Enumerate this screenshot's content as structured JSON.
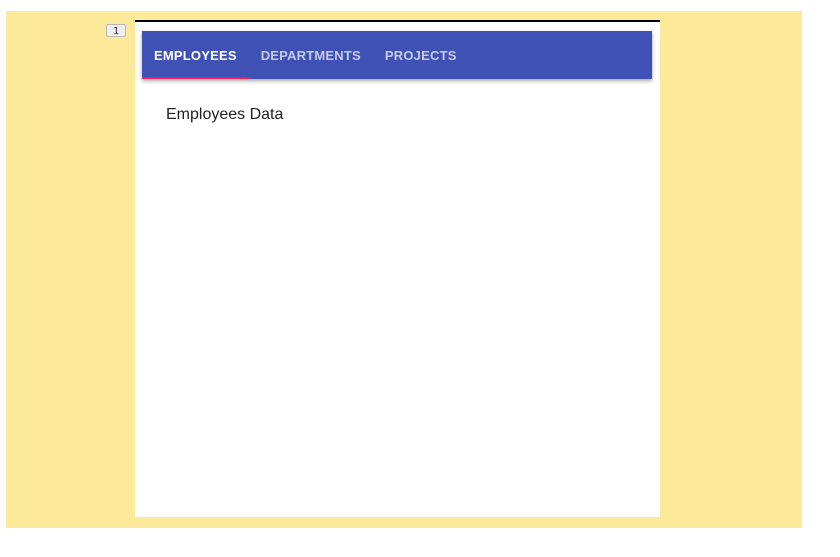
{
  "badge": {
    "label": "1"
  },
  "tabs": [
    {
      "label": "EMPLOYEES",
      "active": true
    },
    {
      "label": "DEPARTMENTS",
      "active": false
    },
    {
      "label": "PROJECTS",
      "active": false
    }
  ],
  "content": {
    "text": "Employees Data"
  },
  "colors": {
    "background": "#fce99a",
    "tabbar": "#3f51b5",
    "indicator": "#e91e63"
  }
}
